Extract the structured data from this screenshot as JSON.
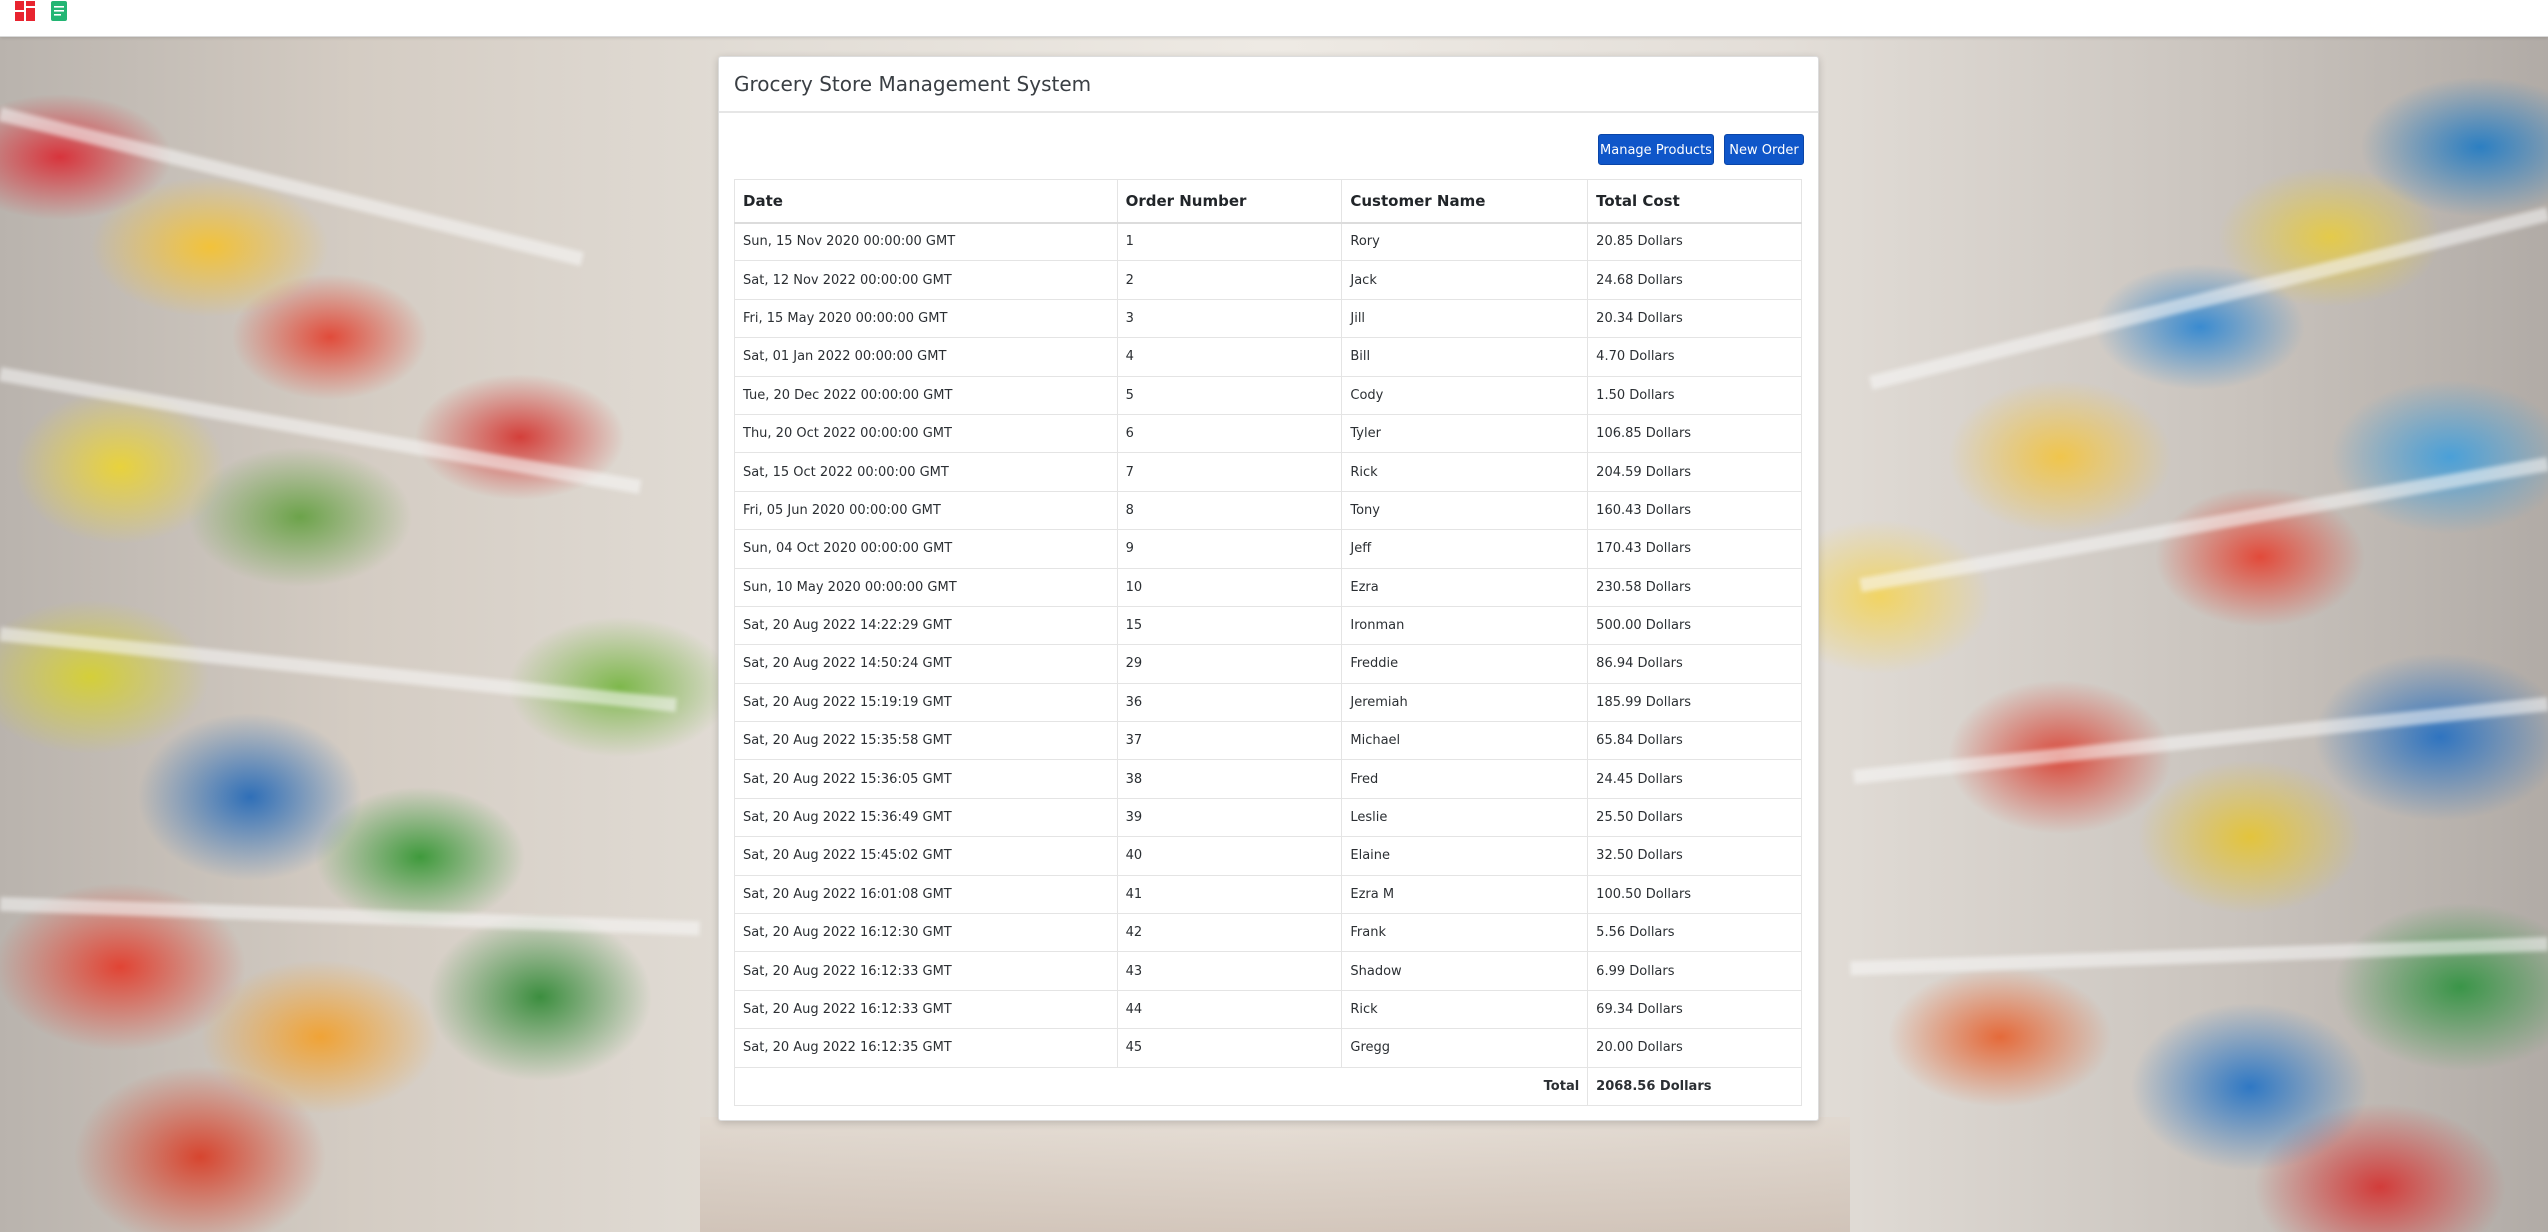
{
  "toolbar": {
    "icons": [
      "grid-apps-icon",
      "document-icon"
    ]
  },
  "page": {
    "title": "Grocery Store Management System"
  },
  "actions": {
    "manage_products": "Manage Products",
    "new_order": "New Order"
  },
  "table": {
    "headers": {
      "date": "Date",
      "order_number": "Order Number",
      "customer_name": "Customer Name",
      "total_cost": "Total Cost"
    },
    "rows": [
      {
        "date": "Sun, 15 Nov 2020 00:00:00 GMT",
        "order_number": "1",
        "customer_name": "Rory",
        "total_cost": "20.85 Dollars"
      },
      {
        "date": "Sat, 12 Nov 2022 00:00:00 GMT",
        "order_number": "2",
        "customer_name": "Jack",
        "total_cost": "24.68 Dollars"
      },
      {
        "date": "Fri, 15 May 2020 00:00:00 GMT",
        "order_number": "3",
        "customer_name": "Jill",
        "total_cost": "20.34 Dollars"
      },
      {
        "date": "Sat, 01 Jan 2022 00:00:00 GMT",
        "order_number": "4",
        "customer_name": "Bill",
        "total_cost": "4.70 Dollars"
      },
      {
        "date": "Tue, 20 Dec 2022 00:00:00 GMT",
        "order_number": "5",
        "customer_name": "Cody",
        "total_cost": "1.50 Dollars"
      },
      {
        "date": "Thu, 20 Oct 2022 00:00:00 GMT",
        "order_number": "6",
        "customer_name": "Tyler",
        "total_cost": "106.85 Dollars"
      },
      {
        "date": "Sat, 15 Oct 2022 00:00:00 GMT",
        "order_number": "7",
        "customer_name": "Rick",
        "total_cost": "204.59 Dollars"
      },
      {
        "date": "Fri, 05 Jun 2020 00:00:00 GMT",
        "order_number": "8",
        "customer_name": "Tony",
        "total_cost": "160.43 Dollars"
      },
      {
        "date": "Sun, 04 Oct 2020 00:00:00 GMT",
        "order_number": "9",
        "customer_name": "Jeff",
        "total_cost": "170.43 Dollars"
      },
      {
        "date": "Sun, 10 May 2020 00:00:00 GMT",
        "order_number": "10",
        "customer_name": "Ezra",
        "total_cost": "230.58 Dollars"
      },
      {
        "date": "Sat, 20 Aug 2022 14:22:29 GMT",
        "order_number": "15",
        "customer_name": "Ironman",
        "total_cost": "500.00 Dollars"
      },
      {
        "date": "Sat, 20 Aug 2022 14:50:24 GMT",
        "order_number": "29",
        "customer_name": "Freddie",
        "total_cost": "86.94 Dollars"
      },
      {
        "date": "Sat, 20 Aug 2022 15:19:19 GMT",
        "order_number": "36",
        "customer_name": "Jeremiah",
        "total_cost": "185.99 Dollars"
      },
      {
        "date": "Sat, 20 Aug 2022 15:35:58 GMT",
        "order_number": "37",
        "customer_name": "Michael",
        "total_cost": "65.84 Dollars"
      },
      {
        "date": "Sat, 20 Aug 2022 15:36:05 GMT",
        "order_number": "38",
        "customer_name": "Fred",
        "total_cost": "24.45 Dollars"
      },
      {
        "date": "Sat, 20 Aug 2022 15:36:49 GMT",
        "order_number": "39",
        "customer_name": "Leslie",
        "total_cost": "25.50 Dollars"
      },
      {
        "date": "Sat, 20 Aug 2022 15:45:02 GMT",
        "order_number": "40",
        "customer_name": "Elaine",
        "total_cost": "32.50 Dollars"
      },
      {
        "date": "Sat, 20 Aug 2022 16:01:08 GMT",
        "order_number": "41",
        "customer_name": "Ezra M",
        "total_cost": "100.50 Dollars"
      },
      {
        "date": "Sat, 20 Aug 2022 16:12:30 GMT",
        "order_number": "42",
        "customer_name": "Frank",
        "total_cost": "5.56 Dollars"
      },
      {
        "date": "Sat, 20 Aug 2022 16:12:33 GMT",
        "order_number": "43",
        "customer_name": "Shadow",
        "total_cost": "6.99 Dollars"
      },
      {
        "date": "Sat, 20 Aug 2022 16:12:33 GMT",
        "order_number": "44",
        "customer_name": "Rick",
        "total_cost": "69.34 Dollars"
      },
      {
        "date": "Sat, 20 Aug 2022 16:12:35 GMT",
        "order_number": "45",
        "customer_name": "Gregg",
        "total_cost": "20.00 Dollars"
      }
    ],
    "footer": {
      "label": "Total",
      "value": "2068.56 Dollars"
    }
  },
  "colors": {
    "button_bg": "#0f56c9",
    "button_text": "#ffffff",
    "grid_icon": "#e8242f",
    "doc_icon": "#22b573"
  }
}
